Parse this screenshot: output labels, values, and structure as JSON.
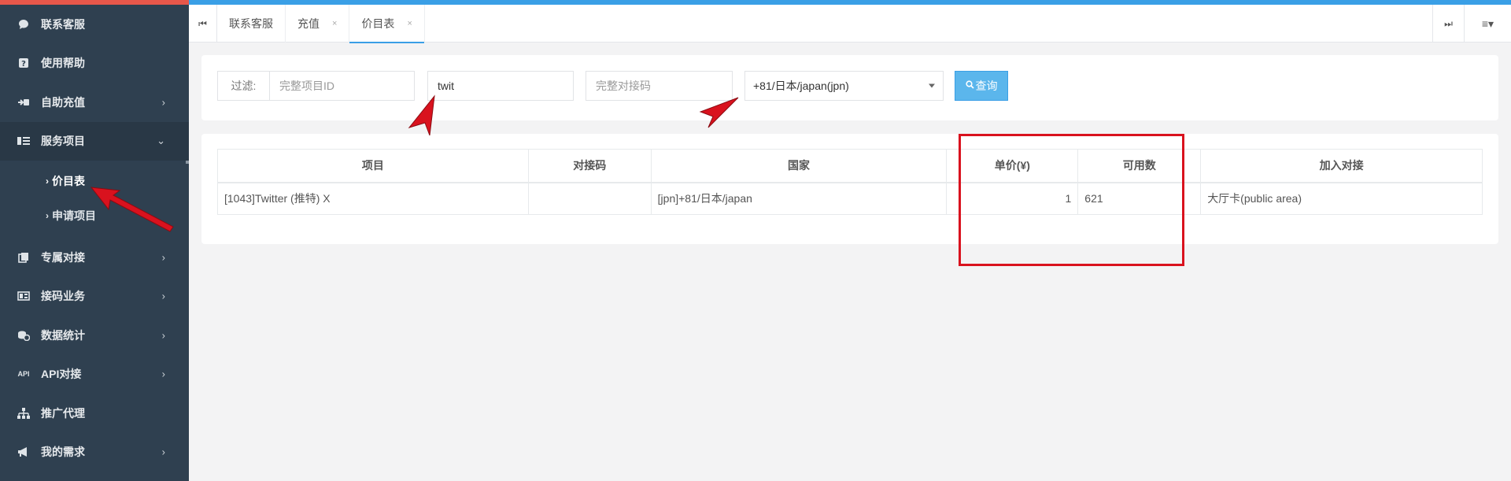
{
  "sidebar": {
    "items": [
      {
        "label": "联系客服",
        "icon": "chat-icon",
        "arrow": ""
      },
      {
        "label": "使用帮助",
        "icon": "help-icon",
        "arrow": ""
      },
      {
        "label": "自助充值",
        "icon": "recharge-icon",
        "arrow": "›"
      },
      {
        "label": "服务项目",
        "icon": "service-icon",
        "arrow": "⌄"
      }
    ],
    "submenu": [
      {
        "label": "价目表"
      },
      {
        "label": "申请项目"
      }
    ],
    "items_after": [
      {
        "label": "专属对接",
        "icon": "dedicated-icon",
        "arrow": "›"
      },
      {
        "label": "接码业务",
        "icon": "sms-icon",
        "arrow": "›"
      },
      {
        "label": "数据统计",
        "icon": "stats-icon",
        "arrow": "›"
      },
      {
        "label": "API对接",
        "icon": "api-icon",
        "arrow": "›",
        "icon_text": "API"
      },
      {
        "label": "推广代理",
        "icon": "sitemap-icon",
        "arrow": ""
      },
      {
        "label": "我的需求",
        "icon": "megaphone-icon",
        "arrow": "›"
      }
    ],
    "sub_caret": "›"
  },
  "tabs": {
    "items": [
      {
        "label": "联系客服",
        "closable": false
      },
      {
        "label": "充值",
        "closable": true
      },
      {
        "label": "价目表",
        "closable": true,
        "active": true
      }
    ],
    "close_glyph": "×",
    "first_glyph": "⏮",
    "last_glyph": "⏭",
    "menu_glyph": "≡▾"
  },
  "filter": {
    "label": "过滤:",
    "project_id_placeholder": "完整项目ID",
    "keyword_value": "twit",
    "code_placeholder": "完整对接码",
    "country_value": "+81/日本/japan(jpn)",
    "query_label": "查询",
    "query_icon": "search-icon"
  },
  "table": {
    "headers": [
      "项目",
      "对接码",
      "国家",
      "单价(¥)",
      "可用数",
      "加入对接"
    ],
    "rows": [
      {
        "project": "[1043]Twitter (推特) X",
        "code": "",
        "country": "[jpn]+81/日本/japan",
        "price": "1",
        "available": "621",
        "join": "大厅卡(public area)"
      }
    ]
  },
  "colors": {
    "accent": "#3a9fe6",
    "sidebar_bg": "#2f4050",
    "annotation_red": "#d9121e",
    "top_red": "#e7574a"
  }
}
